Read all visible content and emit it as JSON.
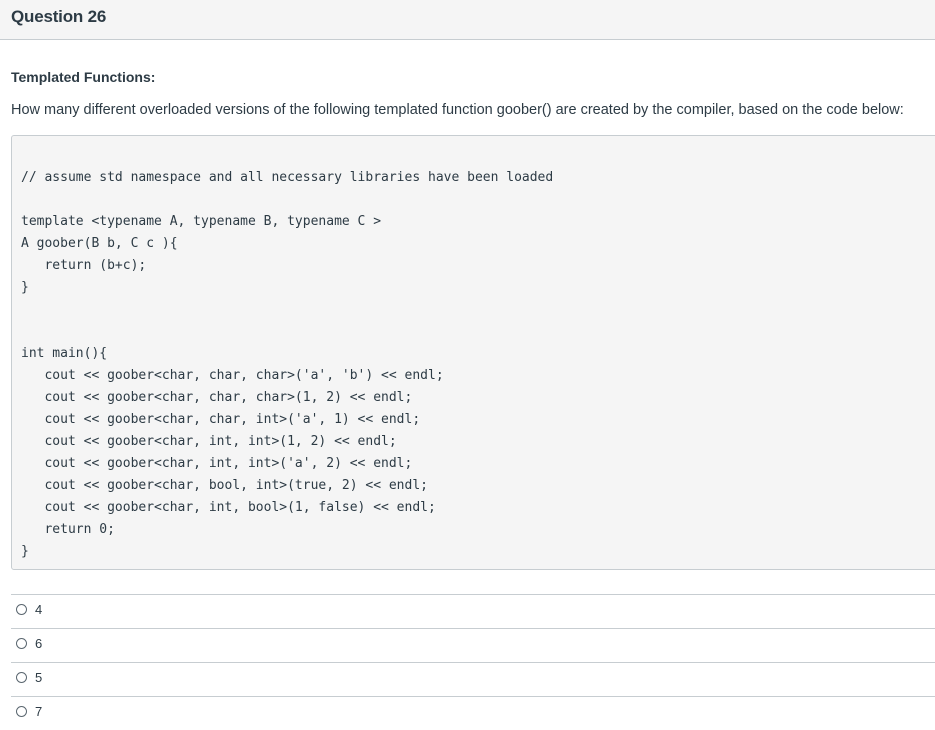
{
  "header": {
    "title": "Question 26"
  },
  "question": {
    "section_title": "Templated Functions:",
    "text": "How many different overloaded versions of the following templated function goober() are created by the compiler, based on the code below:"
  },
  "code": {
    "lines": [
      "// assume std namespace and all necessary libraries have been loaded",
      "template <typename A, typename B, typename C >",
      "A goober(B b, C c ){",
      "   return (b+c);",
      "}",
      "int main(){",
      "   cout << goober<char, char, char>('a', 'b') << endl;",
      "   cout << goober<char, char, char>(1, 2) << endl;",
      "   cout << goober<char, char, int>('a', 1) << endl;",
      "   cout << goober<char, int, int>(1, 2) << endl;",
      "   cout << goober<char, int, int>('a', 2) << endl;",
      "   cout << goober<char, bool, int>(true, 2) << endl;",
      "   cout << goober<char, int, bool>(1, false) << endl;",
      "   return 0;",
      "}"
    ]
  },
  "answers": [
    {
      "label": "4"
    },
    {
      "label": "6"
    },
    {
      "label": "5"
    },
    {
      "label": "7"
    }
  ]
}
